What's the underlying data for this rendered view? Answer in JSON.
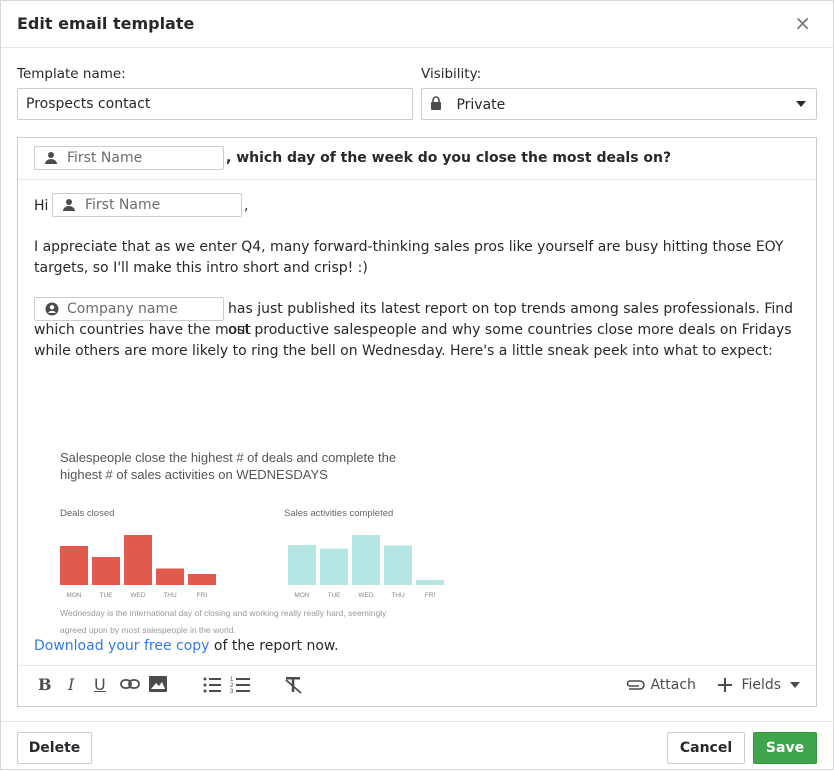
{
  "dialog": {
    "title": "Edit email template",
    "close_glyph": "×"
  },
  "form": {
    "template_name_label": "Template name:",
    "template_name_value": "Prospects contact",
    "visibility_label": "Visibility:",
    "visibility_value": "Private",
    "visibility_icon": "lock-icon"
  },
  "editor": {
    "subject": {
      "field_chip": "First Name",
      "text": ", which day of the week do you close the most deals on?"
    },
    "body": {
      "greeting": "Hi",
      "greeting_chip": "First Name",
      "greeting_suffix": ",",
      "paragraph1": "I appreciate that as we enter Q4, many forward-thinking sales pros like yourself are busy hitting those EOY targets, so I'll make this intro short and crisp! :)",
      "company_chip": "Company name",
      "paragraph2_line1": "has just published its latest report on top trends among sales professionals. Find out",
      "paragraph2_rest": "which countries have the most productive salespeople and why some countries close more deals on Fridays while others are more likely to ring the bell on Wednesday. Here's a little sneak peek into what to expect:",
      "download_link": "Download your free copy",
      "download_suffix": " of the report now."
    },
    "toolbar": {
      "attach_label": "Attach",
      "fields_label": "Fields"
    }
  },
  "embedded_image": {
    "title_line1": "Salespeople close the highest # of deals and complete the",
    "title_line2": "highest # of sales activities on WEDNESDAYS",
    "caption_line1": "Wednesday is the international day of closing and working really really hard, seemingly",
    "caption_line2": "agreed upon by most salespeople in the world.",
    "charts": [
      {
        "label": "Deals closed",
        "color": "#e05a4e",
        "days": [
          "MON",
          "TUE",
          "WED",
          "THU",
          "FRI"
        ],
        "values": [
          0.78,
          0.56,
          1.0,
          0.33,
          0.22
        ]
      },
      {
        "label": "Sales activities completed",
        "color": "#b5e6e4",
        "days": [
          "MON",
          "TUE",
          "WED",
          "THU",
          "FRI"
        ],
        "values": [
          0.8,
          0.73,
          1.0,
          0.79,
          0.1
        ]
      }
    ]
  },
  "footer": {
    "delete_label": "Delete",
    "cancel_label": "Cancel",
    "save_label": "Save"
  },
  "colors": {
    "save_button": "#3ea54c",
    "link": "#317ae2",
    "deals_bar": "#e05a4e",
    "activities_bar": "#b5e6e4"
  }
}
